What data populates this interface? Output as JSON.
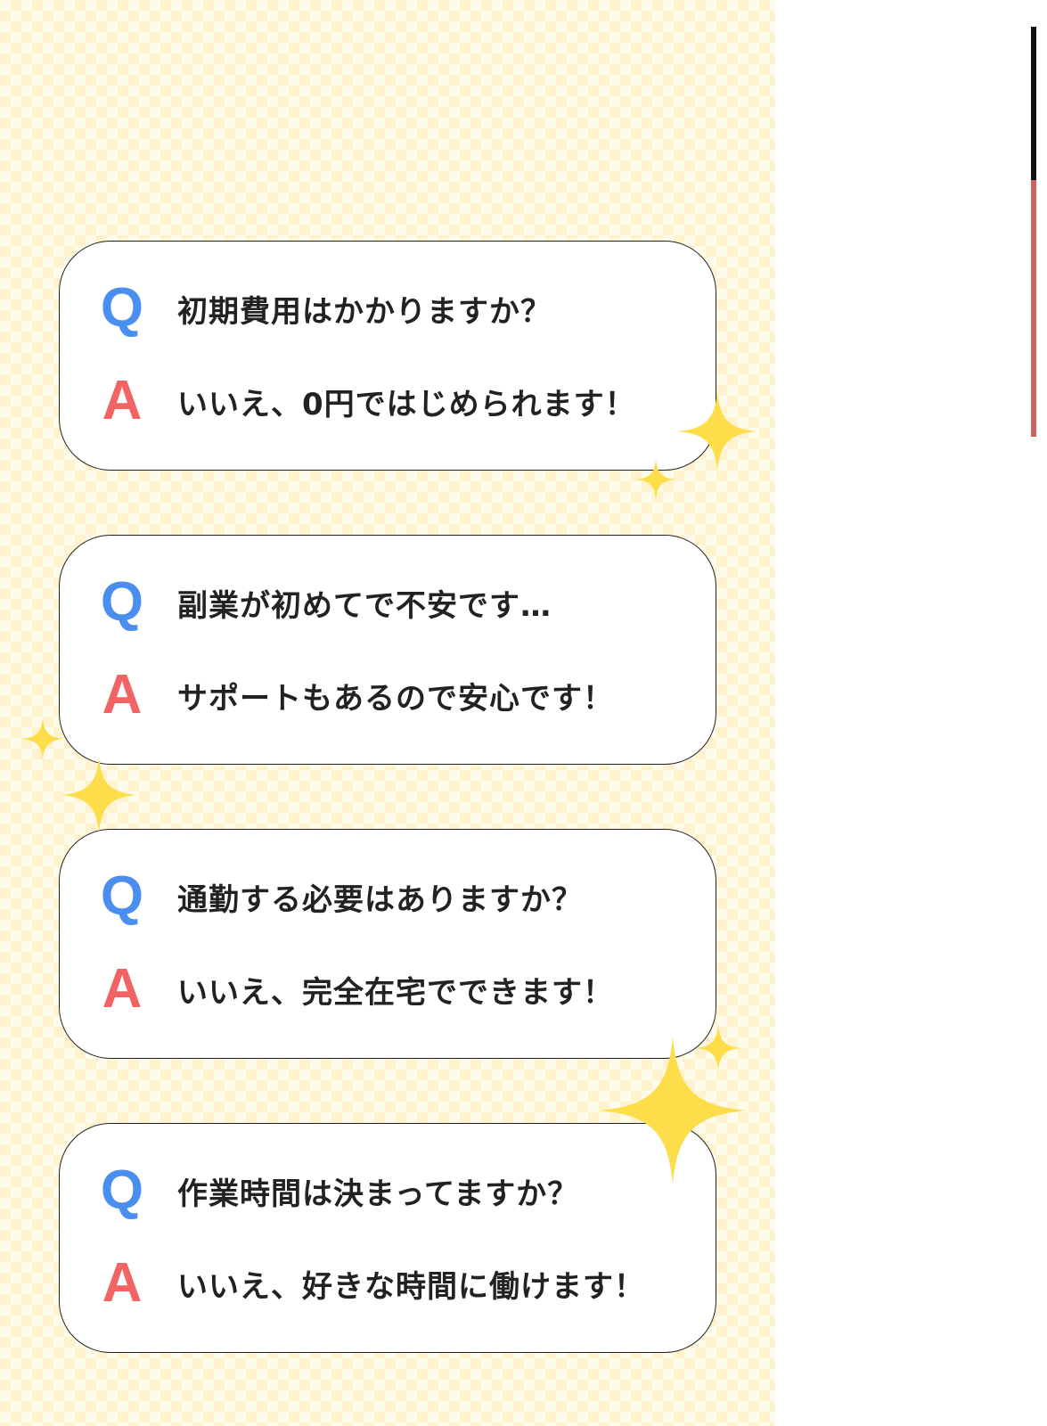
{
  "colors": {
    "question_letter": "#4a8ff0",
    "answer_letter": "#f26363",
    "sparkle": "#fddd4a",
    "background_check": "#fff3cf"
  },
  "faq": [
    {
      "q_letter": "Q",
      "question": "初期費用はかかりますか？",
      "a_letter": "A",
      "answer": "いいえ、0円ではじめられます！"
    },
    {
      "q_letter": "Q",
      "question": "副業が初めてで不安です…",
      "a_letter": "A",
      "answer": "サポートもあるので安心です！"
    },
    {
      "q_letter": "Q",
      "question": "通勤する必要はありますか？",
      "a_letter": "A",
      "answer": "いいえ、完全在宅でできます！"
    },
    {
      "q_letter": "Q",
      "question": "作業時間は決まってますか？",
      "a_letter": "A",
      "answer": "いいえ、好きな時間に働けます！"
    }
  ],
  "icons": {
    "sparkle": "sparkle-icon"
  }
}
